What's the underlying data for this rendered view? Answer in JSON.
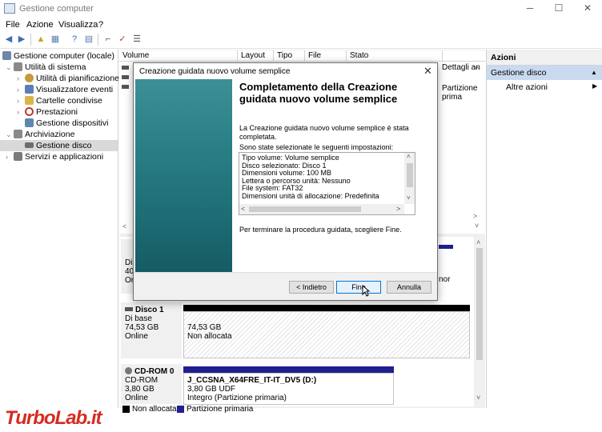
{
  "window": {
    "title": "Gestione computer",
    "minimize": "─",
    "maximize": "☐",
    "close": "✕"
  },
  "menu": [
    "File",
    "Azione",
    "Visualizza",
    "?"
  ],
  "tree": [
    {
      "label": "Gestione computer (locale)",
      "indent": 0,
      "arrow": "",
      "color": "#6f87a8"
    },
    {
      "label": "Utilità di sistema",
      "indent": 1,
      "arrow": "⌄",
      "color": "#8a8a8a"
    },
    {
      "label": "Utilità di pianificazione",
      "indent": 2,
      "arrow": "›",
      "color": "#c79b3b"
    },
    {
      "label": "Visualizzatore eventi",
      "indent": 2,
      "arrow": "›",
      "color": "#5b7fb5"
    },
    {
      "label": "Cartelle condivise",
      "indent": 2,
      "arrow": "›",
      "color": "#d9b54a"
    },
    {
      "label": "Prestazioni",
      "indent": 2,
      "arrow": "›",
      "color": "#c0392b"
    },
    {
      "label": "Gestione dispositivi",
      "indent": 2,
      "arrow": "",
      "color": "#5f86b3"
    },
    {
      "label": "Archiviazione",
      "indent": 1,
      "arrow": "⌄",
      "color": "#8a8a8a"
    },
    {
      "label": "Gestione disco",
      "indent": 2,
      "arrow": "",
      "color": "#6d6d6d"
    },
    {
      "label": "Servizi e applicazioni",
      "indent": 1,
      "arrow": "›",
      "color": "#7b7b7b"
    }
  ],
  "columns": [
    "Volume",
    "Layout",
    "Tipo",
    "File system",
    "Stato",
    "Dettagli an"
  ],
  "list_fragments": {
    "row_detail": "Dettagli an",
    "row_partition": "Partizione prima"
  },
  "disk_fragments": {
    "disk0_a": "Di",
    "disk0_b": "40",
    "disk0_c": "Or",
    "disk0_d": "nor"
  },
  "disks": {
    "disk1": {
      "name": "Disco 1",
      "type": "Di base",
      "size": "74,53 GB",
      "status": "Online",
      "vol_size": "74,53 GB",
      "vol_state": "Non allocata"
    },
    "cdrom": {
      "name": "CD-ROM 0",
      "type": "CD-ROM",
      "size": "3,80 GB",
      "status": "Online",
      "vol_name": "J_CCSNA_X64FRE_IT-IT_DV5  (D:)",
      "vol_size": "3,80 GB UDF",
      "vol_state": "Integro (Partizione primaria)"
    }
  },
  "legend": {
    "unallocated": "Non allocata",
    "primary": "Partizione primaria"
  },
  "actions": {
    "heading": "Azioni",
    "section": "Gestione disco",
    "item": "Altre azioni"
  },
  "dialog": {
    "title": "Creazione guidata nuovo volume semplice",
    "heading": "Completamento della Creazione guidata nuovo volume semplice",
    "intro": "La Creazione guidata nuovo volume semplice è stata completata.",
    "selected": "Sono state selezionate le seguenti impostazioni:",
    "settings": [
      "Tipo volume: Volume semplice",
      "Disco selezionato: Disco 1",
      "Dimensioni volume: 100 MB",
      "Lettera o percorso unità: Nessuno",
      "File system: FAT32",
      "Dimensioni unità di allocazione: Predefinita"
    ],
    "finish_text": "Per terminare la procedura guidata, scegliere Fine.",
    "back": "< Indietro",
    "finish": "Fine",
    "cancel": "Annulla"
  },
  "watermark": "TurboLab.it",
  "colors": {
    "accent": "#0078d7",
    "primary_partition": "#1f1f8f",
    "unallocated": "#000000",
    "action_section": "#c9daf0"
  }
}
